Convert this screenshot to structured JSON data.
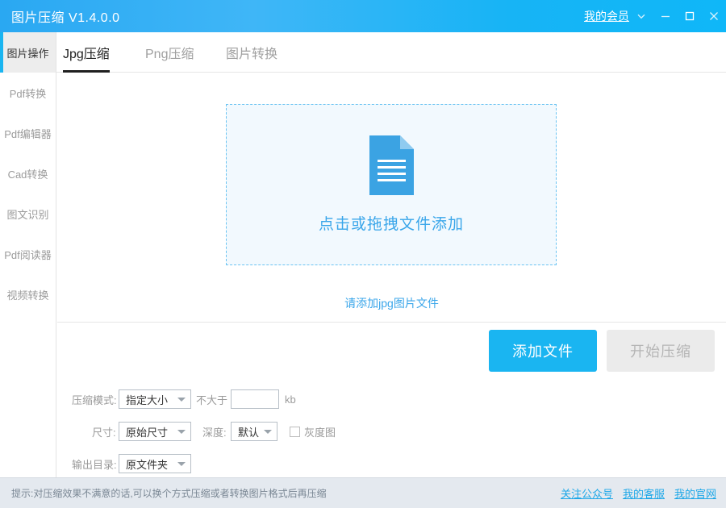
{
  "window": {
    "title": "图片压缩 V1.4.0.0",
    "member_link": "我的会员",
    "icons": {
      "chevron": "chevron-down-icon",
      "minimize": "minimize-icon",
      "maximize": "maximize-icon",
      "close": "close-icon"
    },
    "accent_color": "#1ab5f1",
    "titlebar_gradient_from": "#2aa8f2",
    "titlebar_gradient_to": "#0fb7f8"
  },
  "sidebar": {
    "items": [
      {
        "label": "图片操作",
        "active": true
      },
      {
        "label": "Pdf转换",
        "active": false
      },
      {
        "label": "Pdf编辑器",
        "active": false
      },
      {
        "label": "Cad转换",
        "active": false
      },
      {
        "label": "图文识别",
        "active": false
      },
      {
        "label": "Pdf阅读器",
        "active": false
      },
      {
        "label": "视频转换",
        "active": false
      }
    ]
  },
  "tabs": [
    {
      "label": "Jpg压缩",
      "active": true
    },
    {
      "label": "Png压缩",
      "active": false
    },
    {
      "label": "图片转换",
      "active": false
    }
  ],
  "dropzone": {
    "text": "点击或拖拽文件添加",
    "icon": "document-icon",
    "border_color": "#6cc4f2",
    "background": "#f2f9fe",
    "text_color": "#3aa6ea"
  },
  "hint": {
    "text": "请添加jpg图片文件",
    "color": "#3aa6ea"
  },
  "buttons": {
    "add_file": "添加文件",
    "start_compress": "开始压缩",
    "add_file_enabled": true,
    "start_compress_enabled": false
  },
  "options": {
    "mode_label": "压缩模式:",
    "mode_value": "指定大小",
    "limit_label": "不大于",
    "limit_value": "",
    "limit_placeholder": "",
    "limit_unit": "kb",
    "size_label": "尺寸:",
    "size_value": "原始尺寸",
    "depth_label": "深度:",
    "depth_value": "默认",
    "gray_label": "灰度图",
    "gray_checked": false,
    "output_label": "输出目录:",
    "output_value": "原文件夹"
  },
  "footer": {
    "tip": "提示:对压缩效果不满意的话,可以换个方式压缩或者转换图片格式后再压缩",
    "links": [
      {
        "label": "关注公众号"
      },
      {
        "label": "我的客服"
      },
      {
        "label": "我的官网"
      }
    ],
    "background": "#e4e9ef",
    "link_color": "#1ea8e8"
  }
}
